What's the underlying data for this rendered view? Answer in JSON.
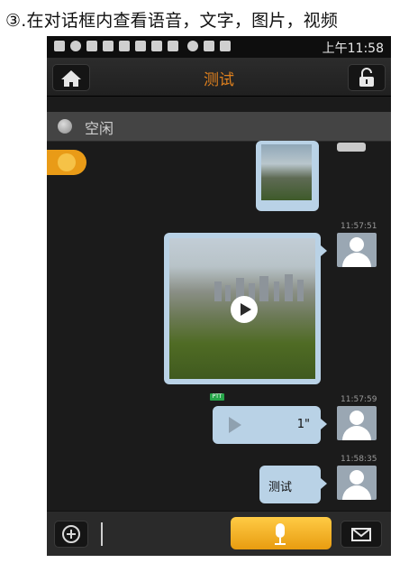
{
  "caption": "③.在对话框内查看语音，文字，图片，视频",
  "status_bar": {
    "time": "上午11:58"
  },
  "header": {
    "title": "测试",
    "icons": [
      "home-icon",
      "unlock-icon"
    ]
  },
  "user_status": {
    "text": "空闲"
  },
  "messages": [
    {
      "type": "image",
      "timestamp": ""
    },
    {
      "type": "video",
      "timestamp": "11:57:51"
    },
    {
      "type": "voice",
      "timestamp": "11:57:59",
      "badge": "PTT",
      "duration": "1\""
    },
    {
      "type": "text",
      "timestamp": "11:58:35",
      "text": "测试"
    }
  ],
  "bottom": {
    "icons": [
      "plus-icon",
      "mic-icon",
      "envelope-icon"
    ]
  },
  "colors": {
    "accent": "#e0811e",
    "bubble": "#b9d2e6",
    "background": "#1b1b1b",
    "ptt_badge": "#27a64a"
  }
}
